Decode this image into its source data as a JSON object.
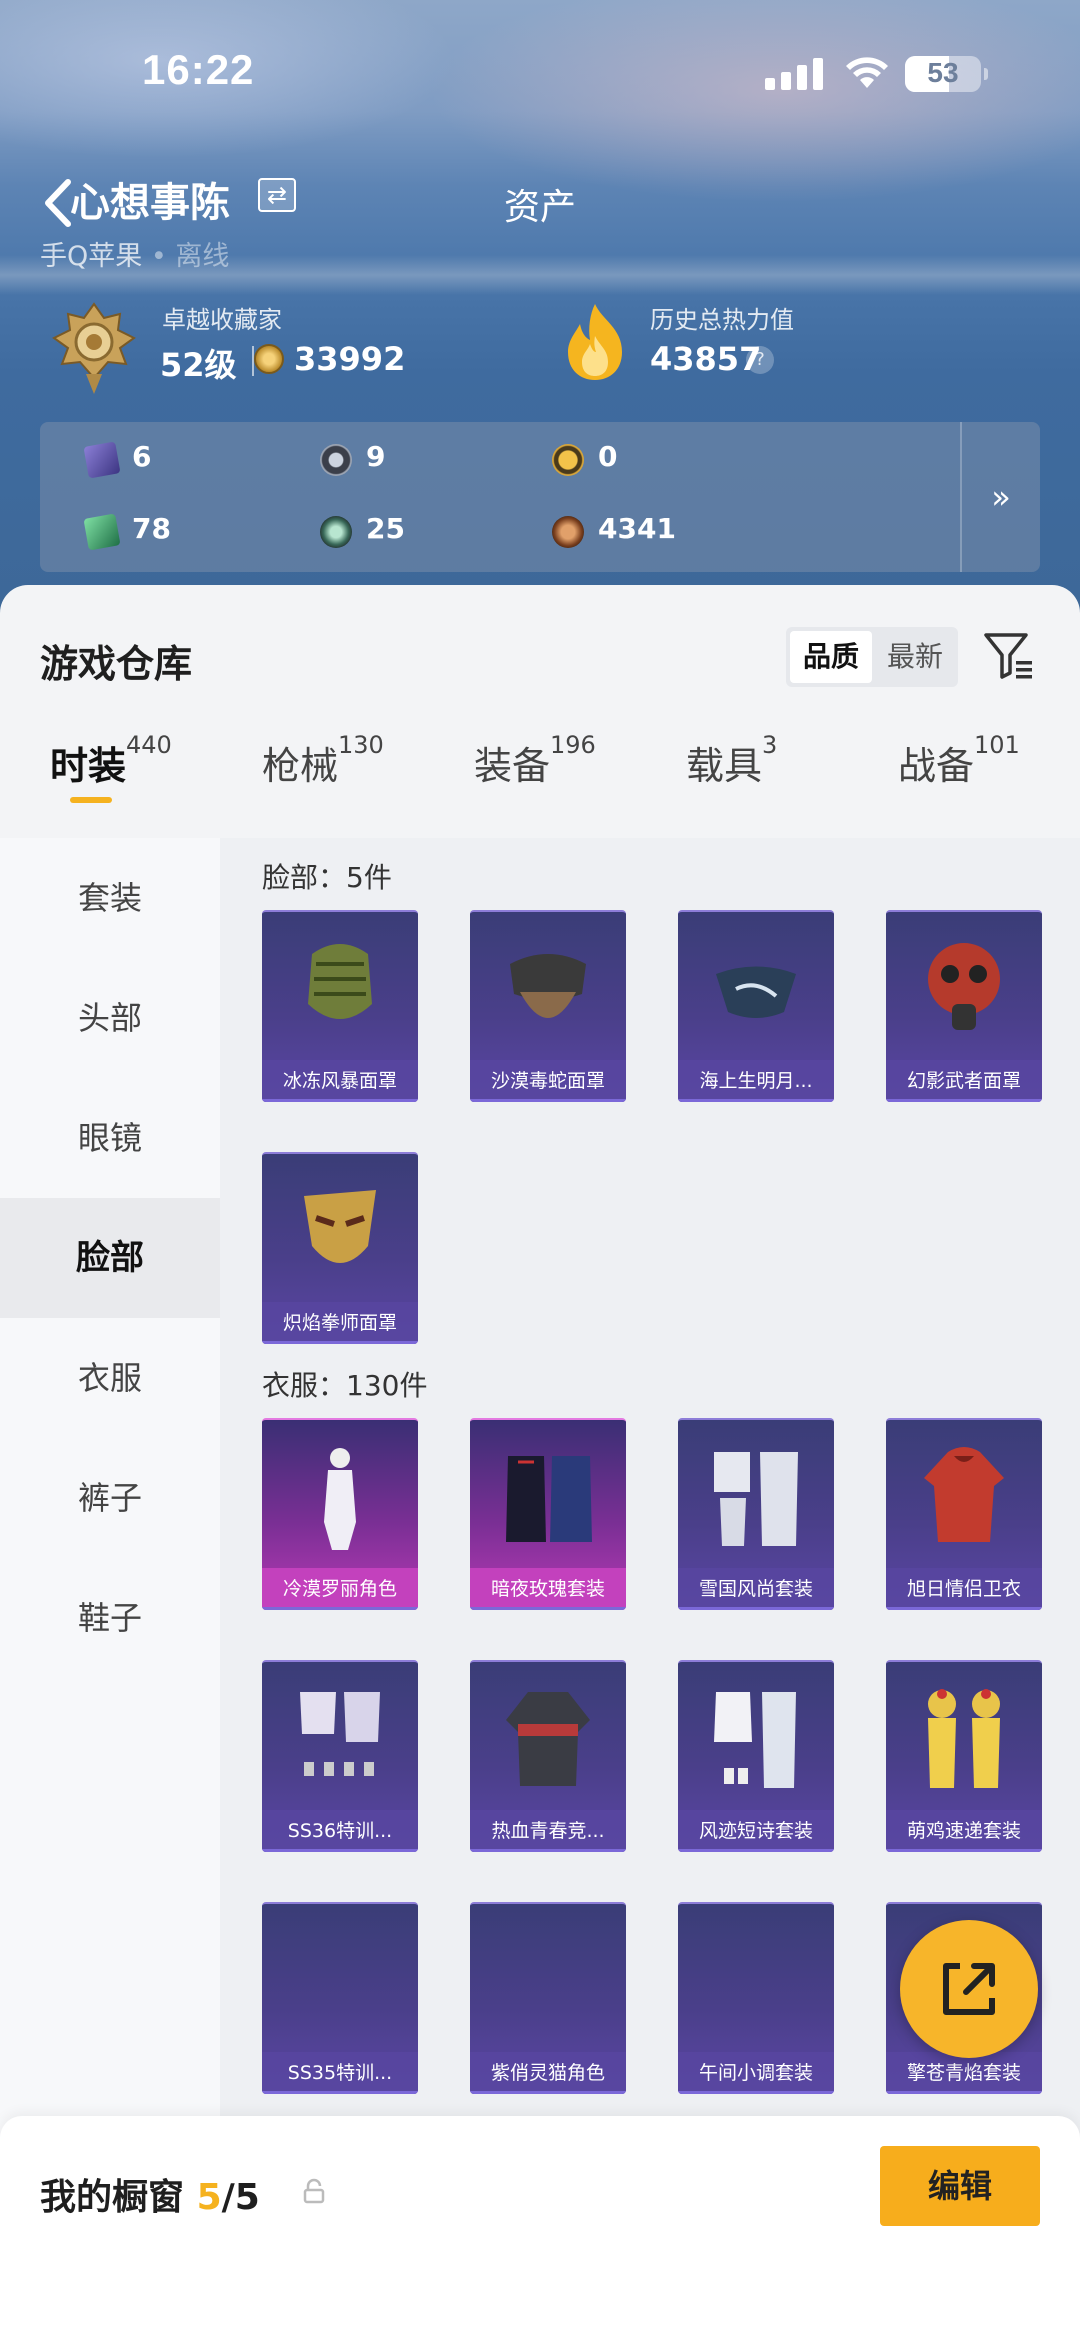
{
  "status_bar": {
    "time": "16:22",
    "battery": "53"
  },
  "header": {
    "player_name": "心想事陈",
    "page_title": "资产",
    "account_type": "手Q苹果",
    "dot": "•",
    "online_status": "离线"
  },
  "collection": {
    "title_label": "卓越收藏家",
    "level": "52级",
    "coins": "33992"
  },
  "heat": {
    "label": "历史总热力值",
    "value": "43857",
    "help": "?"
  },
  "currencies": [
    {
      "icon": "card-icon",
      "value": "6"
    },
    {
      "icon": "round-token-icon",
      "value": "9"
    },
    {
      "icon": "gold-badge-icon",
      "value": "0"
    },
    {
      "icon": "green-card-icon",
      "value": "78"
    },
    {
      "icon": "green-orb-icon",
      "value": "25"
    },
    {
      "icon": "bronze-coin-icon",
      "value": "4341"
    }
  ],
  "currency_more": "»",
  "warehouse": {
    "title": "游戏仓库",
    "sort_options": [
      "品质",
      "最新"
    ],
    "tabs": [
      {
        "label": "时装",
        "count": "440"
      },
      {
        "label": "枪械",
        "count": "130"
      },
      {
        "label": "装备",
        "count": "196"
      },
      {
        "label": "载具",
        "count": "3"
      },
      {
        "label": "战备",
        "count": "101"
      }
    ],
    "categories": [
      "套装",
      "头部",
      "眼镜",
      "脸部",
      "衣服",
      "裤子",
      "鞋子"
    ],
    "sections": [
      {
        "heading": "脸部：5件",
        "items": [
          "冰冻风暴面罩",
          "沙漠毒蛇面罩",
          "海上生明月...",
          "幻影武者面罩",
          "炽焰拳师面罩"
        ]
      },
      {
        "heading": "衣服：130件",
        "items": [
          "冷漠罗丽角色",
          "暗夜玫瑰套装",
          "雪国风尚套装",
          "旭日情侣卫衣",
          "SS36特训...",
          "热血青春竞...",
          "风迹短诗套装",
          "萌鸡速递套装",
          "SS35特训...",
          "紫俏灵猫角色",
          "午间小调套装",
          "擎苍青焰套装"
        ]
      }
    ]
  },
  "showcase": {
    "label": "我的橱窗",
    "current": "5",
    "total": "/5",
    "edit_label": "编辑"
  },
  "colors": {
    "accent": "#f5b21f",
    "card_purple": "#4a3f8a",
    "card_pink": "#b83ab5"
  }
}
